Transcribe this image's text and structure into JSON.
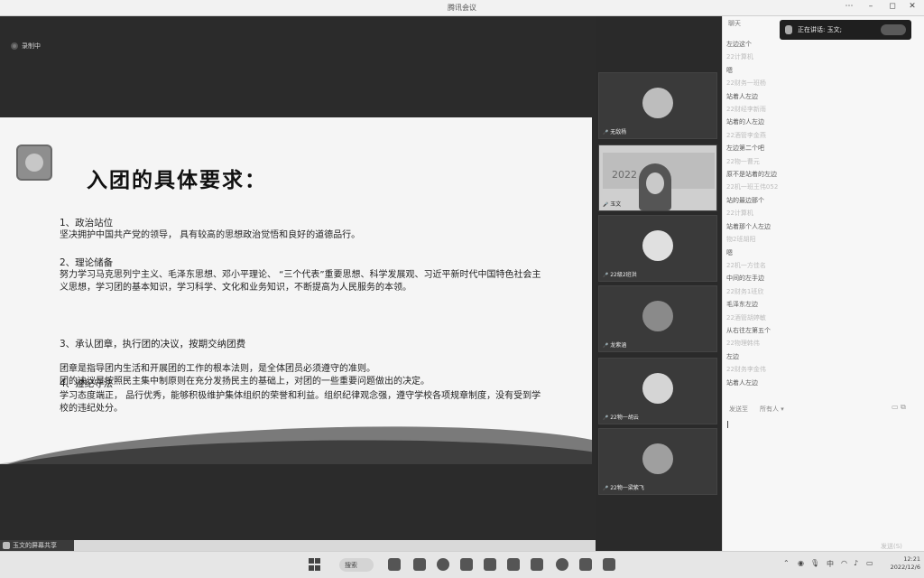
{
  "window": {
    "title": "腾讯会议",
    "minimize": "–",
    "maximize": "◻",
    "close": "✕",
    "extra": "⋯"
  },
  "recording": {
    "label": "录制中"
  },
  "slide": {
    "heading": "入团的具体要求：",
    "sections": [
      {
        "title": "1、政治站位",
        "body": "坚决拥护中国共产党的领导，  具有较高的思想政治觉悟和良好的道德品行。"
      },
      {
        "title": "2、理论储备",
        "body": "努力学习马克思列宁主义、毛泽东思想、邓小平理论、 “三个代表”重要思想、科学发展观、习近平新时代中国特色社会主义思想，学习团的基本知识，学习科学、文化和业务知识，不断提高为人民服务的本领。"
      },
      {
        "title": "3、承认团章，执行团的决议，按期交纳团费",
        "body": "团章是指导团内生活和开展团的工作的根本法则，是全体团员必须遵守的准则。\n团的决议是按照民主集中制原则在充分发扬民主的基础上，对团的一些重要问题做出的决定。"
      },
      {
        "title": "4、遵纪守法",
        "body": "学习态度端正，  品行优秀，能够积极维护集体组织的荣誉和利益。组织纪律观念强，遵守学校各项规章制度，没有受到学校的违纪处分。"
      }
    ]
  },
  "share_indicator": "玉文的屏幕共享",
  "participants": [
    {
      "name": "无敌杨"
    },
    {
      "name": "玉文",
      "poster_text": "2022"
    },
    {
      "name": "22级2班洪"
    },
    {
      "name": "龙紫涵"
    },
    {
      "name": "22物一胡云"
    },
    {
      "name": "22物一梁紫飞"
    }
  ],
  "chat": {
    "header": "聊天",
    "speaking_label": "正在讲话: 玉文;",
    "messages": [
      {
        "kind": "t",
        "text": "左边这个"
      },
      {
        "kind": "n",
        "text": "22计算机"
      },
      {
        "kind": "t",
        "text": "嗯"
      },
      {
        "kind": "n",
        "text": "22财务一班杨"
      },
      {
        "kind": "t",
        "text": "站着人左边"
      },
      {
        "kind": "n",
        "text": "22财经李新雨"
      },
      {
        "kind": "t",
        "text": "站着的人左边"
      },
      {
        "kind": "n",
        "text": "22酒管李金燕"
      },
      {
        "kind": "t",
        "text": "左边第二个吧"
      },
      {
        "kind": "n",
        "text": "22物一曹元"
      },
      {
        "kind": "t",
        "text": "原不是站着的左边"
      },
      {
        "kind": "n",
        "text": "22机一班王伟052"
      },
      {
        "kind": "t",
        "text": "站的最边那个"
      },
      {
        "kind": "n",
        "text": "22计算机"
      },
      {
        "kind": "t",
        "text": "站着那个人左边"
      },
      {
        "kind": "n",
        "text": "物2班胡阳"
      },
      {
        "kind": "t",
        "text": "嗯"
      },
      {
        "kind": "n",
        "text": "22机一方佳名"
      },
      {
        "kind": "t",
        "text": "中间的左手边"
      },
      {
        "kind": "n",
        "text": "22财务1班欣"
      },
      {
        "kind": "t",
        "text": "毛泽东左边"
      },
      {
        "kind": "n",
        "text": "22酒管胡婷敏"
      },
      {
        "kind": "t",
        "text": "从右往左第五个"
      },
      {
        "kind": "n",
        "text": "22物理韩伟"
      },
      {
        "kind": "t",
        "text": "左边"
      },
      {
        "kind": "n",
        "text": "22财务李金伟"
      },
      {
        "kind": "t",
        "text": "站着人左边"
      }
    ],
    "send_to_label": "发送至",
    "send_to_value": "所有人 ▾",
    "send_button": "发送(S)"
  },
  "taskbar": {
    "search_label": "搜索",
    "ime": "中",
    "time": "12:21",
    "date": "2022/12/6"
  }
}
